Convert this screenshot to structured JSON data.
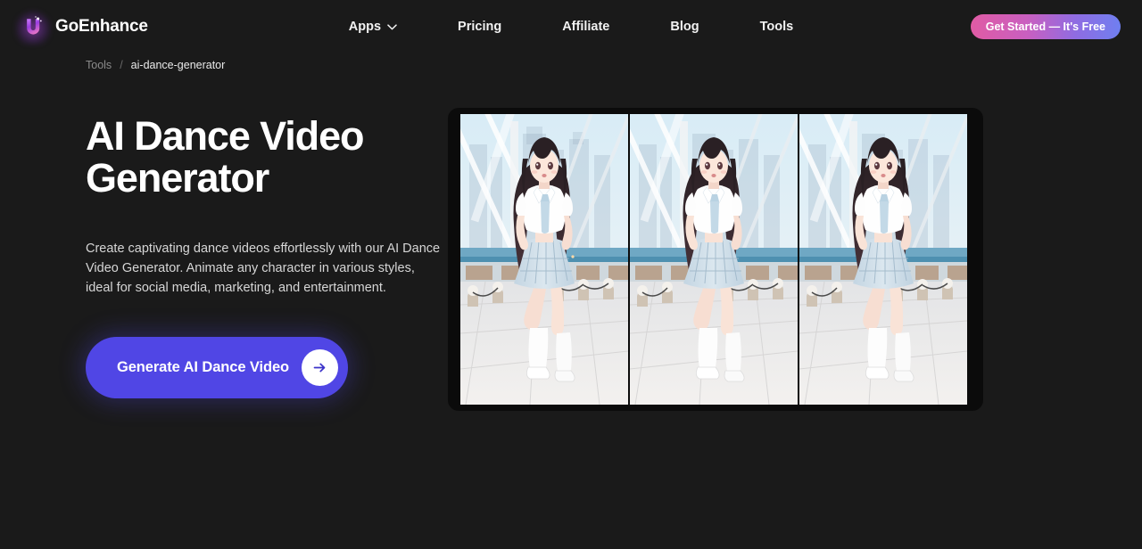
{
  "brand": {
    "name": "GoEnhance",
    "logo_icon": "goenhance-u-logo"
  },
  "nav": {
    "items": [
      {
        "label": "Apps",
        "has_dropdown": true,
        "icon": "chevron-down-icon"
      },
      {
        "label": "Pricing",
        "has_dropdown": false
      },
      {
        "label": "Affiliate",
        "has_dropdown": false
      },
      {
        "label": "Blog",
        "has_dropdown": false
      },
      {
        "label": "Tools",
        "has_dropdown": false
      }
    ],
    "cta": {
      "label": "Get Started — It's Free"
    }
  },
  "breadcrumb": {
    "root": "Tools",
    "separator": "/",
    "current": "ai-dance-generator"
  },
  "hero": {
    "headline": "AI Dance Video Generator",
    "description": "Create captivating dance videos effortlessly with our AI Dance Video Generator. Animate any character in various styles, ideal for social media, marketing, and entertainment.",
    "primary_button": {
      "label": "Generate AI Dance Video",
      "icon": "arrow-right-icon"
    }
  },
  "media": {
    "alt": "Anime schoolgirl dancing on a suspension bridge, three sequential frames",
    "frames": 3
  },
  "colors": {
    "background": "#1a1a1a",
    "primary_button": "#5046e5",
    "cta_gradient_start": "#e05ba4",
    "cta_gradient_end": "#6f7ff0",
    "text_primary": "#ffffff",
    "text_muted": "#8c8c8c"
  }
}
